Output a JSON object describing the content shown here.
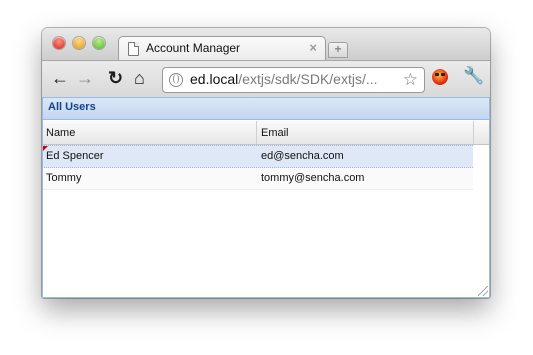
{
  "browser": {
    "tab": {
      "title": "Account Manager",
      "close_glyph": "×"
    },
    "new_tab_glyph": "+",
    "address": {
      "host": "ed.local",
      "path": "/extjs/sdk/SDK/extjs/..."
    },
    "icons": {
      "back": "←",
      "forward": "→",
      "reload": "↻",
      "home": "⌂",
      "star": "☆",
      "wrench": "🔧"
    }
  },
  "grid": {
    "title": "All Users",
    "columns": [
      "Name",
      "Email"
    ],
    "rows": [
      {
        "name": "Ed Spencer",
        "email": "ed@sencha.com",
        "selected": true,
        "dirty": true
      },
      {
        "name": "Tommy",
        "email": "tommy@sencha.com",
        "selected": false,
        "dirty": false
      }
    ]
  },
  "colors": {
    "header_text": "#15428b",
    "selected_row": "#dfe8f6",
    "dirty_marker": "#cc0000"
  }
}
